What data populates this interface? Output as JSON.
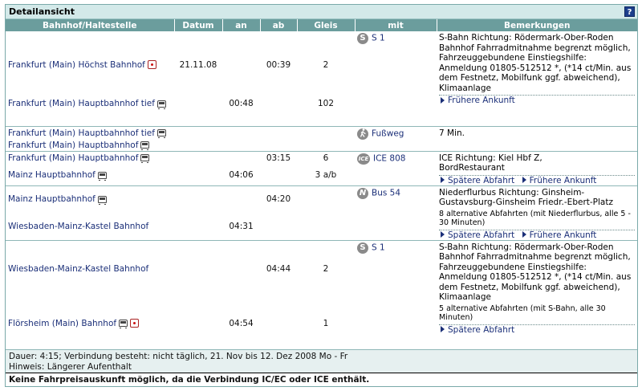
{
  "title": "Detailansicht",
  "help_label": "?",
  "headers": {
    "station": "Bahnhof/Haltestelle",
    "date": "Datum",
    "arr": "an",
    "dep": "ab",
    "track": "Gleis",
    "with": "mit",
    "remarks": "Bemerkungen"
  },
  "sections": [
    {
      "product": "S 1",
      "from": {
        "station": "Frankfurt (Main) Höchst Bahnhof",
        "date": "21.11.08",
        "dep": "00:39",
        "track": "2"
      },
      "to": {
        "station": "Frankfurt (Main) Hauptbahnhof tief",
        "arr": "00:48",
        "track": "102"
      },
      "remarks": "S-Bahn Richtung: Rödermark-Ober-Roden Bahnhof Fahrradmitnahme begrenzt möglich, Fahrzeuggebundene Einstiegshilfe: Anmeldung 01805-512512 *, (*14 ct/Min. aus dem Festnetz, Mobilfunk ggf. abweichend), Klimaanlage",
      "link1": "Frühere Ankunft"
    },
    {
      "product": "Fußweg",
      "from_station": "Frankfurt (Main) Hauptbahnhof tief",
      "to_station": "Frankfurt (Main) Hauptbahnhof",
      "remarks": "7 Min."
    },
    {
      "product": "ICE 808",
      "from": {
        "station": "Frankfurt (Main) Hauptbahnhof",
        "dep": "03:15",
        "track": "6"
      },
      "to": {
        "station": "Mainz Hauptbahnhof",
        "arr": "04:06",
        "track": "3 a/b"
      },
      "remarks": "ICE Richtung: Kiel Hbf Z, BordRestaurant",
      "link1": "Spätere Abfahrt",
      "link2": "Frühere Ankunft"
    },
    {
      "product": "Bus 54",
      "from": {
        "station": "Mainz Hauptbahnhof",
        "dep": "04:20"
      },
      "to": {
        "station": "Wiesbaden-Mainz-Kastel Bahnhof",
        "arr": "04:31"
      },
      "remarks": "Niederflurbus Richtung: Ginsheim-Gustavsburg-Ginsheim Friedr.-Ebert-Platz",
      "remarks2": "8 alternative Abfahrten (mit Niederflurbus, alle 5 - 30 Minuten)",
      "link1": "Spätere Abfahrt",
      "link2": "Frühere Ankunft"
    },
    {
      "product": "S 1",
      "from": {
        "station": "Wiesbaden-Mainz-Kastel Bahnhof",
        "dep": "04:44",
        "track": "2"
      },
      "to": {
        "station": "Flörsheim (Main) Bahnhof",
        "arr": "04:54",
        "track": "1"
      },
      "remarks": "S-Bahn Richtung: Rödermark-Ober-Roden Bahnhof Fahrradmitnahme begrenzt möglich, Fahrzeuggebundene Einstiegshilfe: Anmeldung 01805-512512 *, (*14 ct/Min. aus dem Festnetz, Mobilfunk ggf. abweichend), Klimaanlage",
      "remarks2": "5 alternative Abfahrten (mit S-Bahn, alle 30 Minuten)",
      "link1": "Spätere Abfahrt"
    }
  ],
  "footer": {
    "duration": "Dauer: 4:15; Verbindung besteht: nicht täglich, 21. Nov bis 12. Dez 2008 Mo - Fr",
    "note": "Hinweis: Längerer Aufenthalt",
    "warning": "Keine Fahrpreisauskunft möglich, da die Verbindung IC/EC oder ICE enthält."
  },
  "icons": {
    "s_bahn": "S",
    "walk": "walk-icon",
    "ice": "ICE",
    "bus": "N"
  },
  "colors": {
    "header_bg": "#6b9d9d",
    "title_bg": "#d3e9e9",
    "link": "#1b2f78"
  }
}
